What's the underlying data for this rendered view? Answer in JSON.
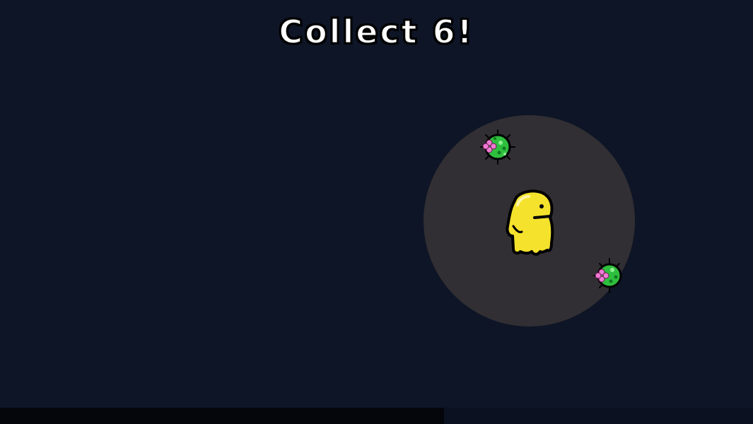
{
  "hud": {
    "objective_text": "Collect 6!"
  },
  "player": {
    "icon": "yellow-blob-character-icon",
    "color": "#f5e22c"
  },
  "pickups": [
    {
      "icon": "green-gem-pickup-icon",
      "color": "#2fbf3f"
    },
    {
      "icon": "green-gem-pickup-icon",
      "color": "#2fbf3f",
      "partially_hidden": true
    }
  ],
  "progress_bar": {
    "fraction": 0.59
  },
  "colors": {
    "background": "#0e1526",
    "spotlight": "#312f33",
    "text": "#ffffff",
    "progress_fill": "#04060c"
  }
}
